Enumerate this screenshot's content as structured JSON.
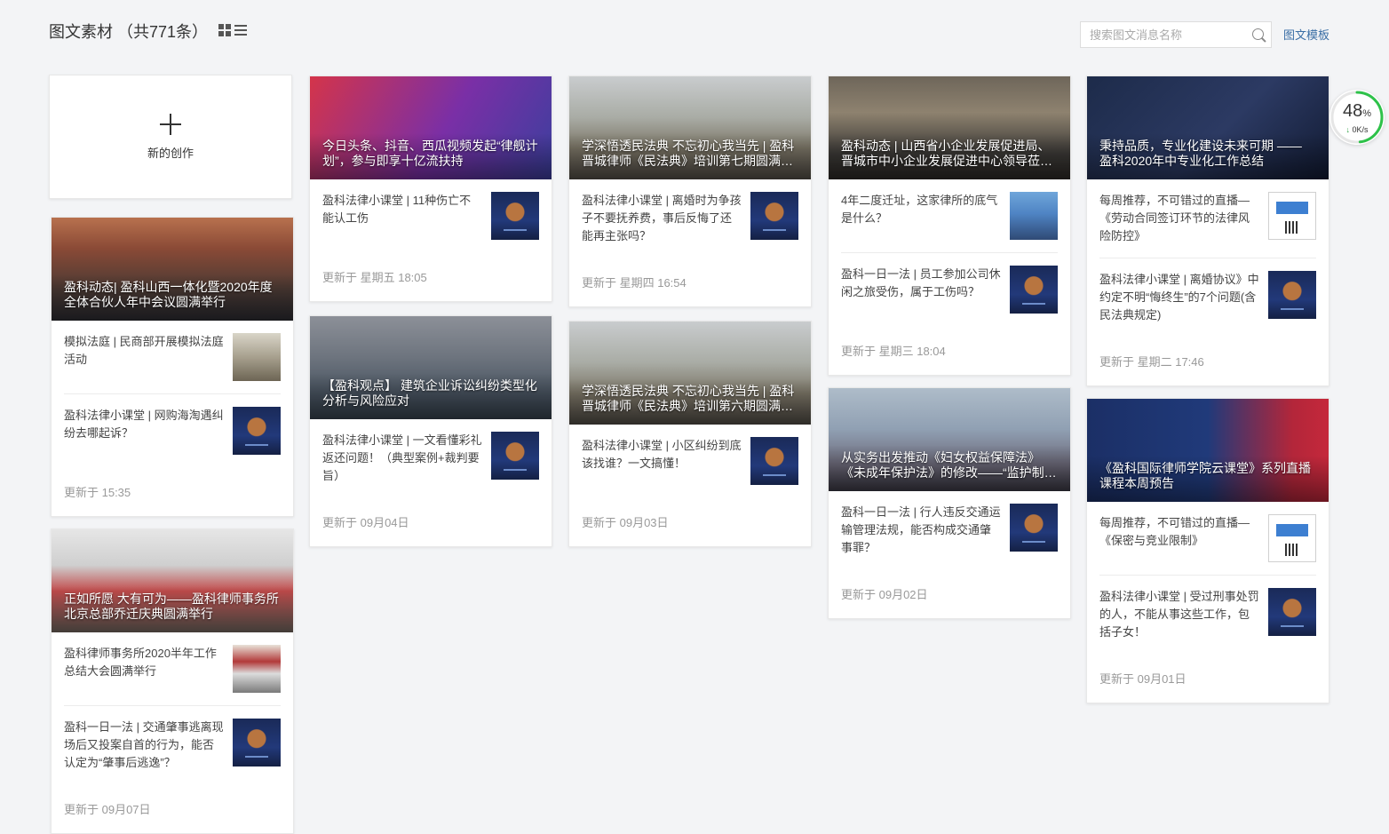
{
  "header": {
    "title": "图文素材 （共771条）",
    "search_placeholder": "搜索图文消息名称",
    "template_link": "图文模板"
  },
  "new_card": {
    "label": "新的创作"
  },
  "speed_widget": {
    "percent": "48",
    "percent_unit": "%",
    "rate": "0K/s"
  },
  "cards": [
    {
      "cover_title": "盈科动态| 盈科山西一体化暨2020年度全体合伙人年中会议圆满举行",
      "items": [
        {
          "text": "模拟法庭 | 民商部开展模拟法庭活动"
        },
        {
          "text": "盈科法律小课堂 | 网购海淘遇纠纷去哪起诉？"
        }
      ],
      "updated": "更新于 15:35"
    },
    {
      "cover_title": "正如所愿 大有可为——盈科律师事务所北京总部乔迁庆典圆满举行",
      "items": [
        {
          "text": "盈科律师事务所2020半年工作总结大会圆满举行"
        },
        {
          "text": "盈科一日一法 | 交通肇事逃离现场后又投案自首的行为，能否认定为“肇事后逃逸”？"
        }
      ],
      "updated": "更新于 09月07日"
    },
    {
      "cover_title": "今日头条、抖音、西瓜视频发起“律舰计划”，参与即享十亿流扶持",
      "items": [
        {
          "text": "盈科法律小课堂 | 11种伤亡不能认工伤"
        }
      ],
      "updated": "更新于 星期五 18:05"
    },
    {
      "cover_title": "【盈科观点】 建筑企业诉讼纠纷类型化分析与风险应对",
      "items": [
        {
          "text": "盈科法律小课堂 | 一文看懂彩礼返还问题！（典型案例+裁判要旨）"
        }
      ],
      "updated": "更新于 09月04日"
    },
    {
      "cover_title": "学深悟透民法典 不忘初心我当先 | 盈科晋城律师《民法典》培训第七期圆满举行",
      "items": [
        {
          "text": "盈科法律小课堂 | 离婚时为争孩子不要抚养费，事后反悔了还能再主张吗？"
        }
      ],
      "updated": "更新于 星期四 16:54"
    },
    {
      "cover_title": "学深悟透民法典 不忘初心我当先 | 盈科晋城律师《民法典》培训第六期圆满举行",
      "items": [
        {
          "text": "盈科法律小课堂 | 小区纠纷到底该找谁？一文搞懂！"
        }
      ],
      "updated": "更新于 09月03日"
    },
    {
      "cover_title": "盈科动态 | 山西省小企业发展促进局、晋城市中小企业发展促进中心领导莅临指导",
      "items": [
        {
          "text": "4年二度迁址，这家律所的底气是什么？"
        },
        {
          "text": "盈科一日一法 | 员工参加公司休闲之旅受伤，属于工伤吗？"
        }
      ],
      "updated": "更新于 星期三 18:04"
    },
    {
      "cover_title": "从实务出发推动《妇女权益保障法》《未成年保护法》的修改——“监护制度”研讨会",
      "items": [
        {
          "text": "盈科一日一法 | 行人违反交通运输管理法规，能否构成交通肇事罪？"
        }
      ],
      "updated": "更新于 09月02日"
    },
    {
      "cover_title": "秉持品质，专业化建设未来可期 —— 盈科2020年中专业化工作总结",
      "items": [
        {
          "text": "每周推荐，不可错过的直播—《劳动合同签订环节的法律风险防控》"
        },
        {
          "text": "盈科法律小课堂 | 离婚协议》中约定不明“悔终生”的7个问题(含民法典规定)"
        }
      ],
      "updated": "更新于 星期二 17:46"
    },
    {
      "cover_title": "《盈科国际律师学院云课堂》系列直播课程本周预告",
      "items": [
        {
          "text": "每周推荐，不可错过的直播—《保密与竞业限制》"
        },
        {
          "text": "盈科法律小课堂 | 受过刑事处罚的人，不能从事这些工作，包括子女！"
        }
      ],
      "updated": "更新于 09月01日"
    }
  ]
}
